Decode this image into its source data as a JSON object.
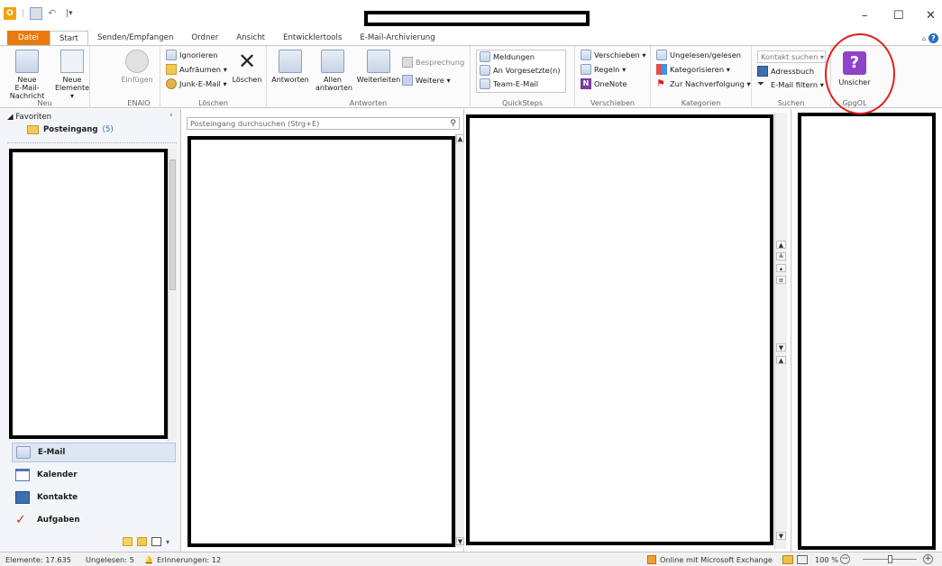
{
  "titlebar": {
    "qat_app_icon": "outlook-icon",
    "qat_separator": "|",
    "window_controls": {
      "minimize": "–",
      "maximize": "☐",
      "close": "✕"
    }
  },
  "tabs": [
    {
      "label": "Datei"
    },
    {
      "label": "Start"
    },
    {
      "label": "Senden/Empfangen"
    },
    {
      "label": "Ordner"
    },
    {
      "label": "Ansicht"
    },
    {
      "label": "Entwicklertools"
    },
    {
      "label": "E-Mail-Archivierung"
    }
  ],
  "ribbon": {
    "neu": {
      "label": "Neu",
      "new_mail_line1": "Neue",
      "new_mail_line2": "E-Mail-Nachricht",
      "new_items_line1": "Neue",
      "new_items_line2": "Elemente ▾"
    },
    "enaio": {
      "label": "ENAIO",
      "paste": "Einfügen"
    },
    "loeschen": {
      "label": "Löschen",
      "ignore": "Ignorieren",
      "cleanup": "Aufräumen ▾",
      "junk": "Junk-E-Mail ▾",
      "delete": "Löschen"
    },
    "antworten": {
      "label": "Antworten",
      "reply": "Antworten",
      "reply_all_line1": "Allen",
      "reply_all_line2": "antworten",
      "forward": "Weiterleiten",
      "meeting": "Besprechung",
      "more": "Weitere ▾"
    },
    "quicksteps": {
      "label": "QuickSteps",
      "items": [
        "Meldungen",
        "An Vorgesetzte(n)",
        "Team-E-Mail"
      ]
    },
    "verschieben": {
      "label": "Verschieben",
      "move": "Verschieben ▾",
      "rules": "Regeln ▾",
      "onenote": "OneNote"
    },
    "kategorien": {
      "label": "Kategorien",
      "unread": "Ungelesen/gelesen",
      "categorize": "Kategorisieren ▾",
      "followup": "Zur Nachverfolgung ▾"
    },
    "suchen": {
      "label": "Suchen",
      "search_contact": "Kontakt suchen ▾",
      "addressbook": "Adressbuch",
      "filter": "E-Mail filtern ▾"
    },
    "gpgol": {
      "label": "GpgOL",
      "button": "Unsicher",
      "icon_glyph": "?"
    }
  },
  "nav": {
    "favorites_header": "◢ Favoriten",
    "collapse": "‹",
    "inbox_label": "Posteingang",
    "inbox_count": "(5)",
    "modules": [
      {
        "label": "E-Mail"
      },
      {
        "label": "Kalender"
      },
      {
        "label": "Kontakte"
      },
      {
        "label": "Aufgaben"
      }
    ],
    "configure": "▾"
  },
  "list": {
    "search_placeholder": "Posteingang durchsuchen (Strg+E)"
  },
  "status": {
    "items": "Elemente: 17.635",
    "unread": "Ungelesen: 5",
    "reminders": "Erinnerungen: 12",
    "exchange": "Online mit Microsoft Exchange",
    "zoom": "100 %",
    "zoom_minus": "−",
    "zoom_plus": "+"
  },
  "colors": {
    "file_tab": "#e87a10",
    "gpgol_icon": "#8e44c8",
    "annotation_circle": "#e02020"
  }
}
